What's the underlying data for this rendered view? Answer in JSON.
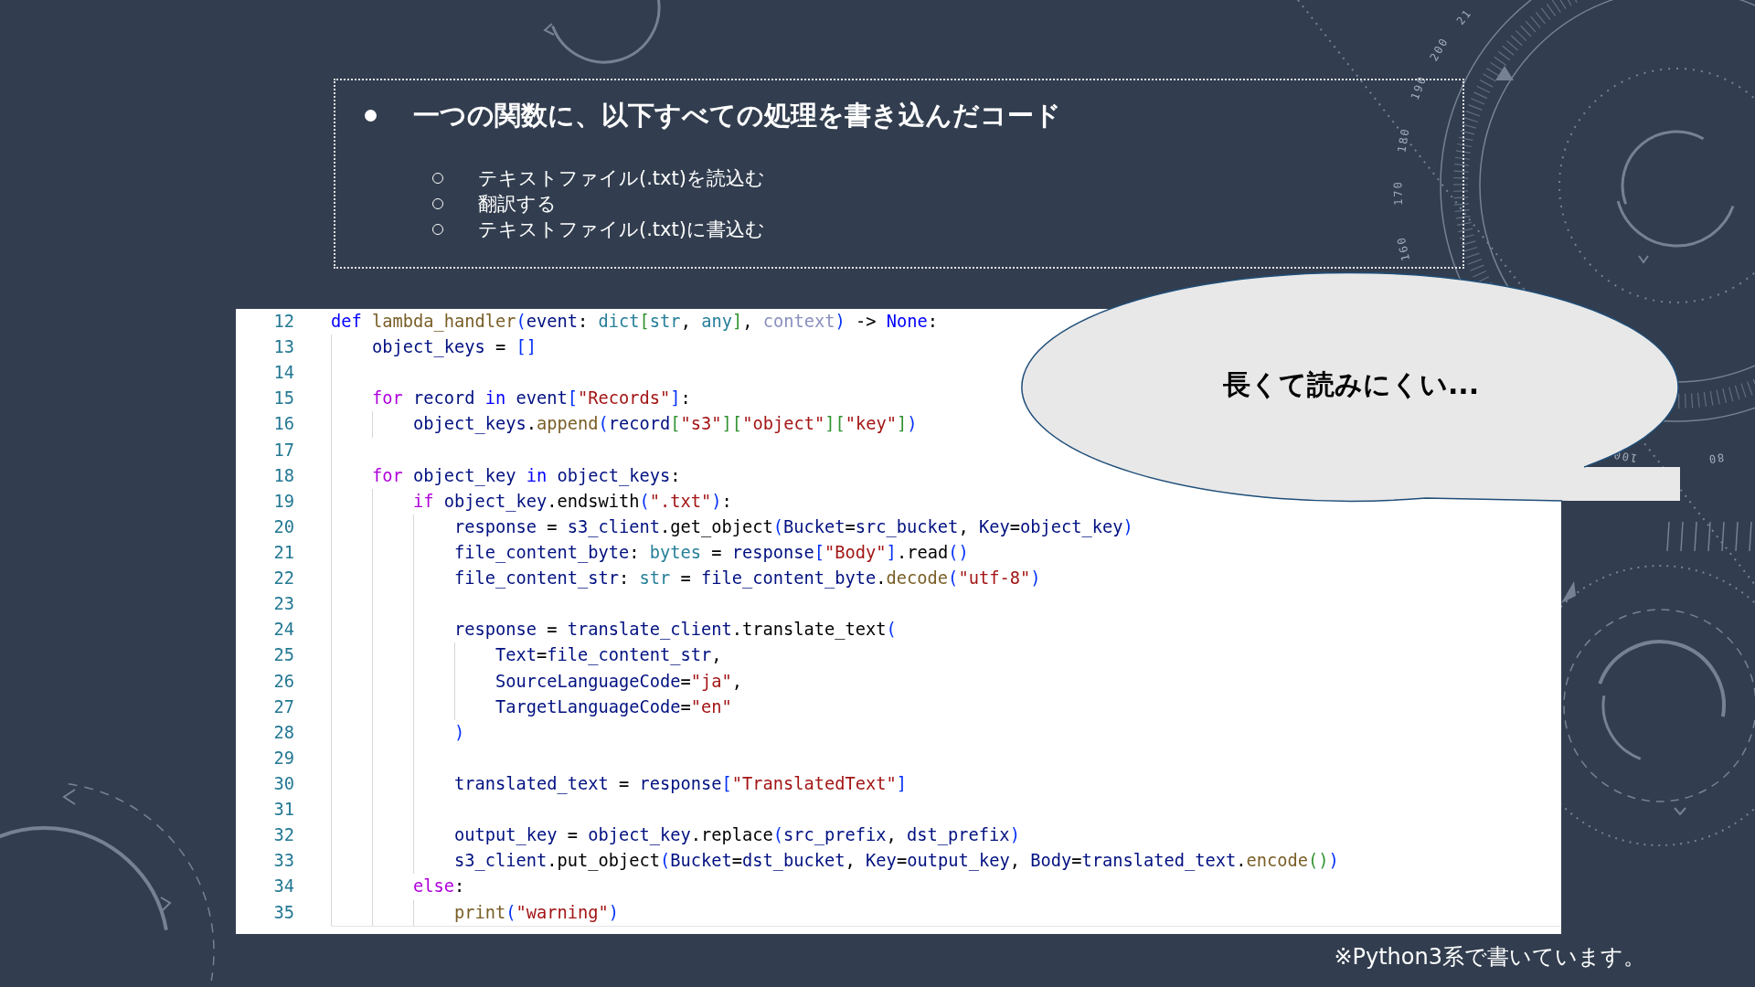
{
  "background": {
    "dial_labels": [
      "21",
      "200",
      "190",
      "180",
      "170",
      "160",
      "100",
      "80"
    ]
  },
  "slide": {
    "summary": {
      "title": "一つの関数に、以下すべての処理を書き込んだコード",
      "items": [
        "テキストファイル(.txt)を読込む",
        "翻訳する",
        "テキストファイル(.txt)に書込む"
      ]
    },
    "code_editor": {
      "lines": [
        {
          "number": "12",
          "tokens": [
            {
              "kind": "keyword",
              "text": "def "
            },
            {
              "kind": "function",
              "text": "lambda_handler"
            },
            {
              "kind": "bracket1",
              "text": "("
            },
            {
              "kind": "variable",
              "text": "event"
            },
            {
              "kind": "plain",
              "text": ": "
            },
            {
              "kind": "type",
              "text": "dict"
            },
            {
              "kind": "bracket2",
              "text": "["
            },
            {
              "kind": "type",
              "text": "str"
            },
            {
              "kind": "plain",
              "text": ", "
            },
            {
              "kind": "type",
              "text": "any"
            },
            {
              "kind": "bracket2",
              "text": "]"
            },
            {
              "kind": "plain",
              "text": ", "
            },
            {
              "kind": "unused",
              "text": "context"
            },
            {
              "kind": "bracket1",
              "text": ")"
            },
            {
              "kind": "plain",
              "text": " -> "
            },
            {
              "kind": "keyword",
              "text": "None"
            },
            {
              "kind": "plain",
              "text": ":"
            }
          ],
          "children": [
            {
              "number": "13",
              "tokens": [
                {
                  "kind": "variable",
                  "text": "object_keys"
                },
                {
                  "kind": "plain",
                  "text": " = "
                },
                {
                  "kind": "bracket1",
                  "text": "[]"
                }
              ]
            },
            {
              "number": "14"
            },
            {
              "number": "15",
              "tokens": [
                {
                  "kind": "control",
                  "text": "for "
                },
                {
                  "kind": "variable",
                  "text": "record"
                },
                {
                  "kind": "keyword",
                  "text": " in "
                },
                {
                  "kind": "variable",
                  "text": "event"
                },
                {
                  "kind": "bracket1",
                  "text": "["
                },
                {
                  "kind": "string",
                  "text": "\"Records\""
                },
                {
                  "kind": "bracket1",
                  "text": "]"
                },
                {
                  "kind": "plain",
                  "text": ":"
                }
              ],
              "children": [
                {
                  "number": "16",
                  "tokens": [
                    {
                      "kind": "variable",
                      "text": "object_keys"
                    },
                    {
                      "kind": "plain",
                      "text": "."
                    },
                    {
                      "kind": "function",
                      "text": "append"
                    },
                    {
                      "kind": "bracket1",
                      "text": "("
                    },
                    {
                      "kind": "variable",
                      "text": "record"
                    },
                    {
                      "kind": "bracket2",
                      "text": "["
                    },
                    {
                      "kind": "string",
                      "text": "\"s3\""
                    },
                    {
                      "kind": "bracket2",
                      "text": "]["
                    },
                    {
                      "kind": "string",
                      "text": "\"object\""
                    },
                    {
                      "kind": "bracket2",
                      "text": "]["
                    },
                    {
                      "kind": "string",
                      "text": "\"key\""
                    },
                    {
                      "kind": "bracket2",
                      "text": "]"
                    },
                    {
                      "kind": "bracket1",
                      "text": ")"
                    }
                  ]
                }
              ]
            },
            {
              "number": "17"
            },
            {
              "number": "18",
              "tokens": [
                {
                  "kind": "control",
                  "text": "for "
                },
                {
                  "kind": "variable",
                  "text": "object_key"
                },
                {
                  "kind": "keyword",
                  "text": " in "
                },
                {
                  "kind": "variable",
                  "text": "object_keys"
                },
                {
                  "kind": "plain",
                  "text": ":"
                }
              ],
              "children": [
                {
                  "number": "19",
                  "tokens": [
                    {
                      "kind": "control",
                      "text": "if "
                    },
                    {
                      "kind": "variable",
                      "text": "object_key"
                    },
                    {
                      "kind": "plain",
                      "text": ".endswith"
                    },
                    {
                      "kind": "bracket1",
                      "text": "("
                    },
                    {
                      "kind": "string",
                      "text": "\".txt\""
                    },
                    {
                      "kind": "bracket1",
                      "text": ")"
                    },
                    {
                      "kind": "plain",
                      "text": ":"
                    }
                  ],
                  "children": [
                    {
                      "number": "20",
                      "tokens": [
                        {
                          "kind": "variable",
                          "text": "response"
                        },
                        {
                          "kind": "plain",
                          "text": " = "
                        },
                        {
                          "kind": "variable",
                          "text": "s3_client"
                        },
                        {
                          "kind": "plain",
                          "text": ".get_object"
                        },
                        {
                          "kind": "bracket1",
                          "text": "("
                        },
                        {
                          "kind": "variable",
                          "text": "Bucket"
                        },
                        {
                          "kind": "plain",
                          "text": "="
                        },
                        {
                          "kind": "variable",
                          "text": "src_bucket"
                        },
                        {
                          "kind": "plain",
                          "text": ", "
                        },
                        {
                          "kind": "variable",
                          "text": "Key"
                        },
                        {
                          "kind": "plain",
                          "text": "="
                        },
                        {
                          "kind": "variable",
                          "text": "object_key"
                        },
                        {
                          "kind": "bracket1",
                          "text": ")"
                        }
                      ]
                    },
                    {
                      "number": "21",
                      "tokens": [
                        {
                          "kind": "variable",
                          "text": "file_content_byte"
                        },
                        {
                          "kind": "plain",
                          "text": ": "
                        },
                        {
                          "kind": "type",
                          "text": "bytes"
                        },
                        {
                          "kind": "plain",
                          "text": " = "
                        },
                        {
                          "kind": "variable",
                          "text": "response"
                        },
                        {
                          "kind": "bracket1",
                          "text": "["
                        },
                        {
                          "kind": "string",
                          "text": "\"Body\""
                        },
                        {
                          "kind": "bracket1",
                          "text": "]"
                        },
                        {
                          "kind": "plain",
                          "text": ".read"
                        },
                        {
                          "kind": "bracket1",
                          "text": "()"
                        }
                      ]
                    },
                    {
                      "number": "22",
                      "tokens": [
                        {
                          "kind": "variable",
                          "text": "file_content_str"
                        },
                        {
                          "kind": "plain",
                          "text": ": "
                        },
                        {
                          "kind": "type",
                          "text": "str"
                        },
                        {
                          "kind": "plain",
                          "text": " = "
                        },
                        {
                          "kind": "variable",
                          "text": "file_content_byte"
                        },
                        {
                          "kind": "plain",
                          "text": "."
                        },
                        {
                          "kind": "function",
                          "text": "decode"
                        },
                        {
                          "kind": "bracket1",
                          "text": "("
                        },
                        {
                          "kind": "string",
                          "text": "\"utf-8\""
                        },
                        {
                          "kind": "bracket1",
                          "text": ")"
                        }
                      ]
                    },
                    {
                      "number": "23"
                    },
                    {
                      "number": "24",
                      "tokens": [
                        {
                          "kind": "variable",
                          "text": "response"
                        },
                        {
                          "kind": "plain",
                          "text": " = "
                        },
                        {
                          "kind": "variable",
                          "text": "translate_client"
                        },
                        {
                          "kind": "plain",
                          "text": ".translate_text"
                        },
                        {
                          "kind": "bracket1",
                          "text": "("
                        }
                      ],
                      "children": [
                        {
                          "number": "25",
                          "tokens": [
                            {
                              "kind": "variable",
                              "text": "Text"
                            },
                            {
                              "kind": "plain",
                              "text": "="
                            },
                            {
                              "kind": "variable",
                              "text": "file_content_str"
                            },
                            {
                              "kind": "plain",
                              "text": ","
                            }
                          ]
                        },
                        {
                          "number": "26",
                          "tokens": [
                            {
                              "kind": "variable",
                              "text": "SourceLanguageCode"
                            },
                            {
                              "kind": "plain",
                              "text": "="
                            },
                            {
                              "kind": "string",
                              "text": "\"ja\""
                            },
                            {
                              "kind": "plain",
                              "text": ","
                            }
                          ]
                        },
                        {
                          "number": "27",
                          "tokens": [
                            {
                              "kind": "variable",
                              "text": "TargetLanguageCode"
                            },
                            {
                              "kind": "plain",
                              "text": "="
                            },
                            {
                              "kind": "string",
                              "text": "\"en\""
                            }
                          ]
                        }
                      ]
                    },
                    {
                      "number": "28",
                      "tokens": [
                        {
                          "kind": "bracket1",
                          "text": ")"
                        }
                      ]
                    },
                    {
                      "number": "29"
                    },
                    {
                      "number": "30",
                      "tokens": [
                        {
                          "kind": "variable",
                          "text": "translated_text"
                        },
                        {
                          "kind": "plain",
                          "text": " = "
                        },
                        {
                          "kind": "variable",
                          "text": "response"
                        },
                        {
                          "kind": "bracket1",
                          "text": "["
                        },
                        {
                          "kind": "string",
                          "text": "\"TranslatedText\""
                        },
                        {
                          "kind": "bracket1",
                          "text": "]"
                        }
                      ]
                    },
                    {
                      "number": "31"
                    },
                    {
                      "number": "32",
                      "tokens": [
                        {
                          "kind": "variable",
                          "text": "output_key"
                        },
                        {
                          "kind": "plain",
                          "text": " = "
                        },
                        {
                          "kind": "variable",
                          "text": "object_key"
                        },
                        {
                          "kind": "plain",
                          "text": ".replace"
                        },
                        {
                          "kind": "bracket1",
                          "text": "("
                        },
                        {
                          "kind": "variable",
                          "text": "src_prefix"
                        },
                        {
                          "kind": "plain",
                          "text": ", "
                        },
                        {
                          "kind": "variable",
                          "text": "dst_prefix"
                        },
                        {
                          "kind": "bracket1",
                          "text": ")"
                        }
                      ]
                    },
                    {
                      "number": "33",
                      "tokens": [
                        {
                          "kind": "variable",
                          "text": "s3_client"
                        },
                        {
                          "kind": "plain",
                          "text": ".put_object"
                        },
                        {
                          "kind": "bracket1",
                          "text": "("
                        },
                        {
                          "kind": "variable",
                          "text": "Bucket"
                        },
                        {
                          "kind": "plain",
                          "text": "="
                        },
                        {
                          "kind": "variable",
                          "text": "dst_bucket"
                        },
                        {
                          "kind": "plain",
                          "text": ", "
                        },
                        {
                          "kind": "variable",
                          "text": "Key"
                        },
                        {
                          "kind": "plain",
                          "text": "="
                        },
                        {
                          "kind": "variable",
                          "text": "output_key"
                        },
                        {
                          "kind": "plain",
                          "text": ", "
                        },
                        {
                          "kind": "variable",
                          "text": "Body"
                        },
                        {
                          "kind": "plain",
                          "text": "="
                        },
                        {
                          "kind": "variable",
                          "text": "translated_text"
                        },
                        {
                          "kind": "plain",
                          "text": "."
                        },
                        {
                          "kind": "function",
                          "text": "encode"
                        },
                        {
                          "kind": "bracket2",
                          "text": "()"
                        },
                        {
                          "kind": "bracket1",
                          "text": ")"
                        }
                      ]
                    }
                  ]
                },
                {
                  "number": "34",
                  "tokens": [
                    {
                      "kind": "control",
                      "text": "else"
                    },
                    {
                      "kind": "plain",
                      "text": ":"
                    }
                  ],
                  "children": [
                    {
                      "number": "35",
                      "tokens": [
                        {
                          "kind": "function",
                          "text": "print"
                        },
                        {
                          "kind": "bracket1",
                          "text": "("
                        },
                        {
                          "kind": "string",
                          "text": "\"warning\""
                        },
                        {
                          "kind": "bracket1",
                          "text": ")"
                        }
                      ]
                    }
                  ]
                }
              ]
            }
          ]
        }
      ]
    },
    "speech_bubble": {
      "text": "長くて読みにくい..."
    },
    "footnote": "※Python3系で書いています。"
  }
}
